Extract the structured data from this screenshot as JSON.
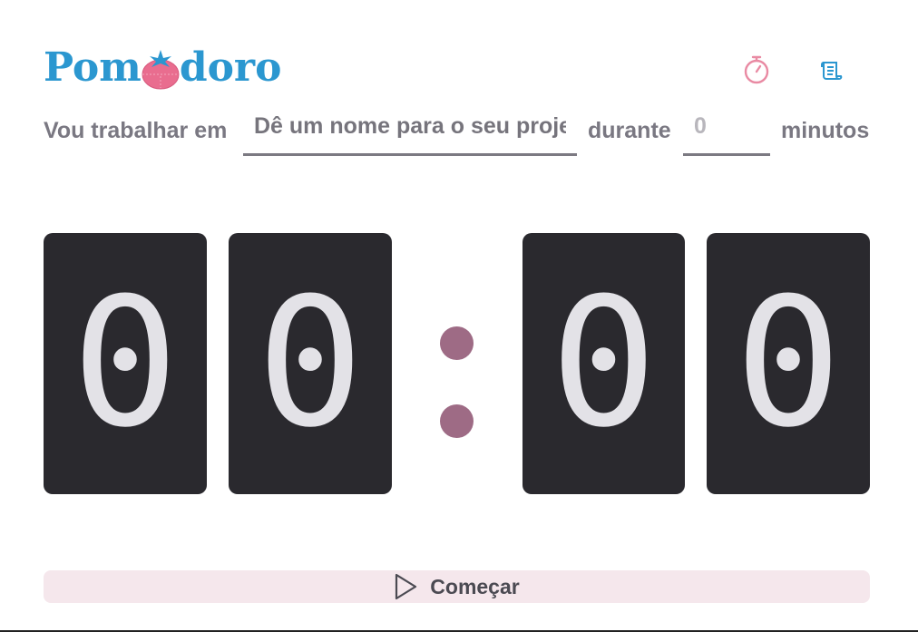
{
  "app": {
    "logo": {
      "part1": "Pom",
      "part2": "doro",
      "color": "#2b97d0",
      "accent": "#e96d8f"
    },
    "header_icons": [
      {
        "name": "stopwatch-icon",
        "color": "#e98aa3"
      },
      {
        "name": "scroll-icon",
        "color": "#2b97d0"
      }
    ]
  },
  "form": {
    "prefix": "Vou trabalhar em",
    "project_placeholder": "Dê um nome para o seu projeto",
    "middle": "durante",
    "minutes_placeholder": "0",
    "suffix": "minutos"
  },
  "timer": {
    "digits": [
      "0",
      "0",
      "0",
      "0"
    ],
    "colon_color": "#9e6b85",
    "card_color": "#2a292e",
    "digit_color": "#e3e2e7"
  },
  "start_button": {
    "label": "Começar",
    "icon": "play-icon"
  }
}
